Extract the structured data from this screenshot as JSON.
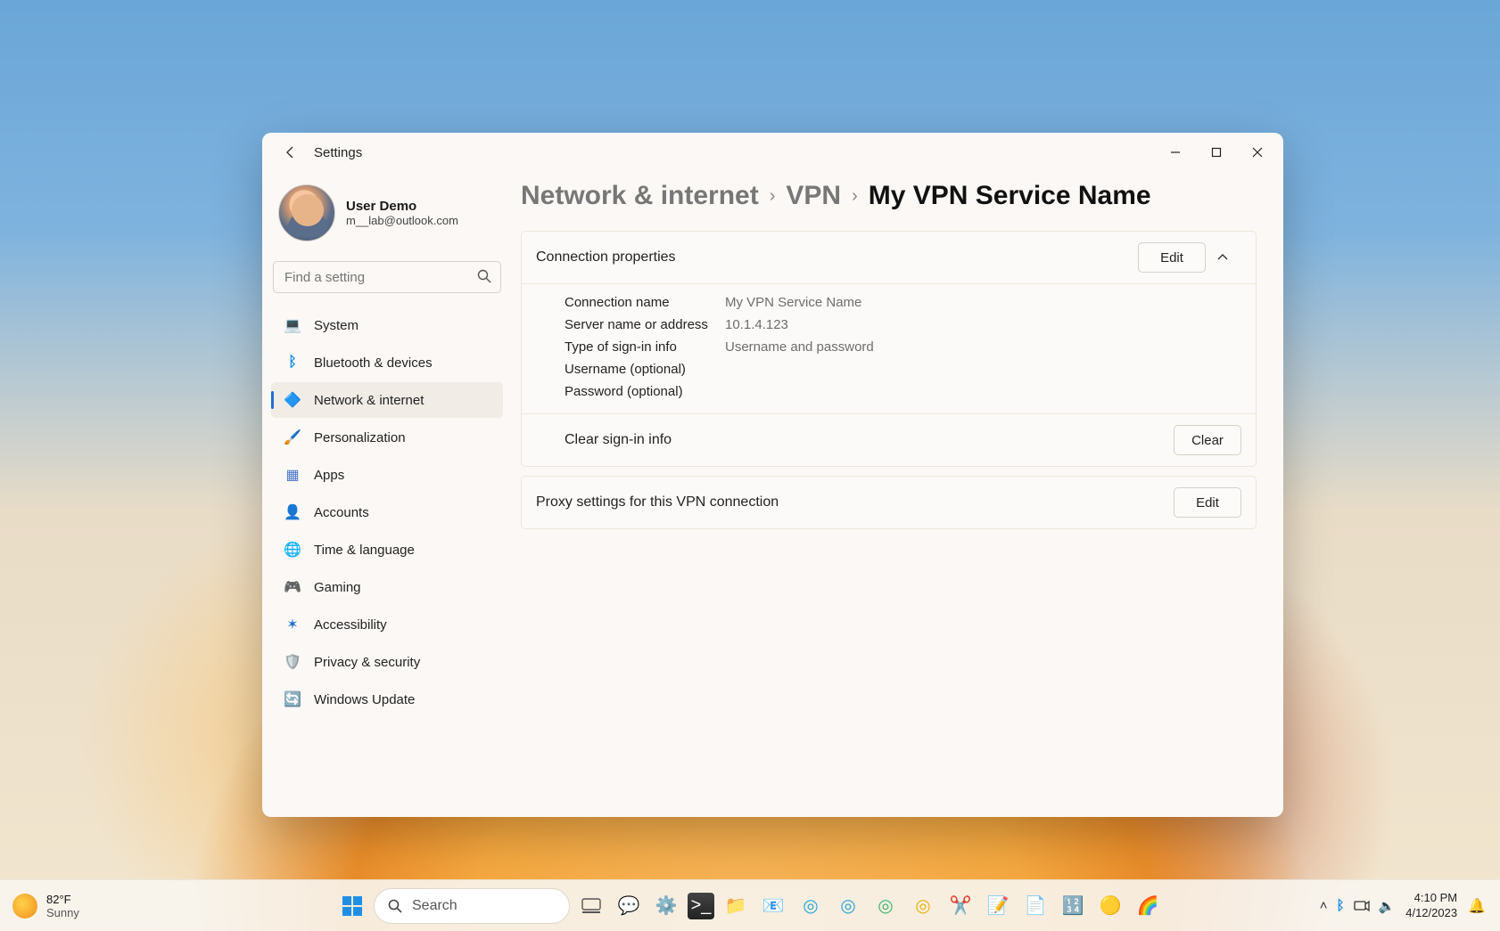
{
  "window": {
    "app_title": "Settings",
    "back_aria": "Back"
  },
  "profile": {
    "name": "User Demo",
    "email": "m__lab@outlook.com"
  },
  "search": {
    "placeholder": "Find a setting"
  },
  "sidebar": {
    "items": [
      {
        "label": "System",
        "icon": "💻"
      },
      {
        "label": "Bluetooth & devices",
        "icon": "ᛒ"
      },
      {
        "label": "Network & internet",
        "icon": "🔷"
      },
      {
        "label": "Personalization",
        "icon": "🖌️"
      },
      {
        "label": "Apps",
        "icon": "▦"
      },
      {
        "label": "Accounts",
        "icon": "👤"
      },
      {
        "label": "Time & language",
        "icon": "🌐"
      },
      {
        "label": "Gaming",
        "icon": "🎮"
      },
      {
        "label": "Accessibility",
        "icon": "✶"
      },
      {
        "label": "Privacy & security",
        "icon": "🛡️"
      },
      {
        "label": "Windows Update",
        "icon": "🔄"
      }
    ],
    "active_index": 2
  },
  "breadcrumb": {
    "seg1": "Network & internet",
    "seg2": "VPN",
    "seg3": "My VPN Service Name"
  },
  "panel": {
    "conn_props_label": "Connection properties",
    "edit_label": "Edit",
    "rows": {
      "r0k": "Connection name",
      "r0v": "My VPN Service Name",
      "r1k": "Server name or address",
      "r1v": "10.1.4.123",
      "r2k": "Type of sign-in info",
      "r2v": "Username and password",
      "r3k": "Username (optional)",
      "r3v": "",
      "r4k": "Password (optional)",
      "r4v": ""
    },
    "clear_label": "Clear sign-in info",
    "clear_btn": "Clear",
    "proxy_label": "Proxy settings for this VPN connection",
    "proxy_btn": "Edit"
  },
  "taskbar": {
    "weather_temp": "82°F",
    "weather_cond": "Sunny",
    "search_placeholder": "Search",
    "time": "4:10 PM",
    "date": "4/12/2023"
  }
}
